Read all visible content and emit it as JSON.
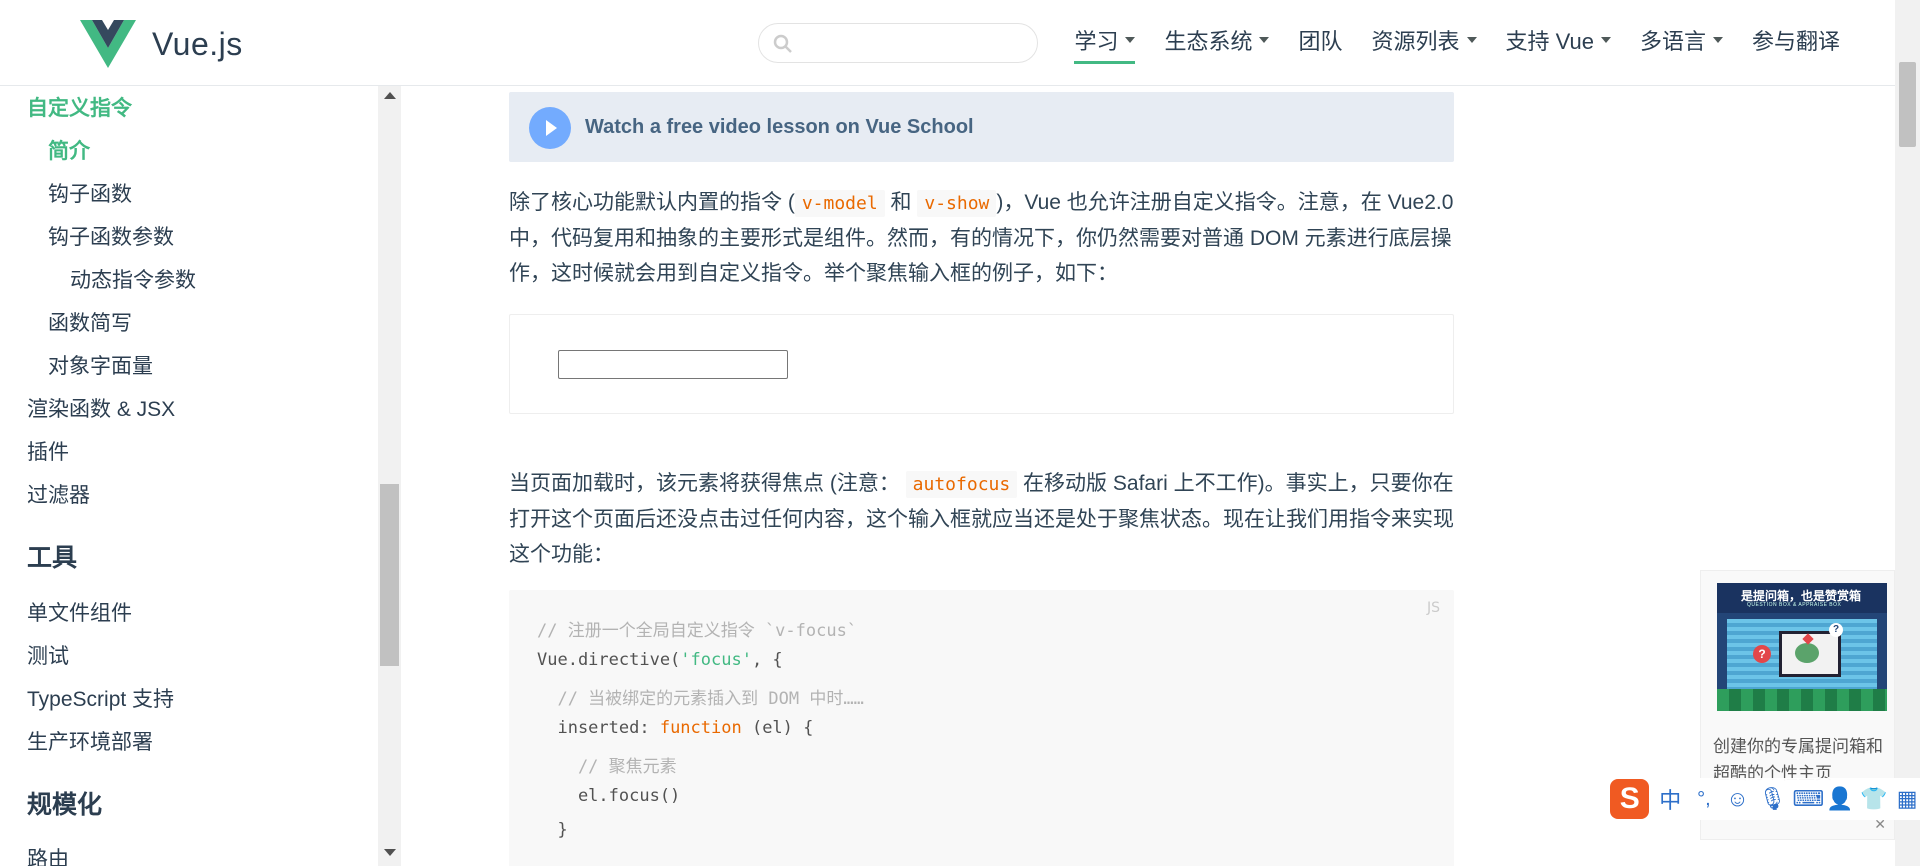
{
  "header": {
    "logo_text": "Vue.js",
    "search_placeholder": "",
    "nav": [
      {
        "label": "学习",
        "dropdown": true,
        "active": true
      },
      {
        "label": "生态系统",
        "dropdown": true
      },
      {
        "label": "团队",
        "dropdown": false
      },
      {
        "label": "资源列表",
        "dropdown": true
      },
      {
        "label": "支持 Vue",
        "dropdown": true
      },
      {
        "label": "多语言",
        "dropdown": true
      },
      {
        "label": "参与翻译",
        "dropdown": false
      }
    ]
  },
  "sidebar": {
    "items": [
      {
        "label": "自定义指令",
        "level": 0,
        "active": true
      },
      {
        "label": "简介",
        "level": 1,
        "active": true
      },
      {
        "label": "钩子函数",
        "level": 1
      },
      {
        "label": "钩子函数参数",
        "level": 1
      },
      {
        "label": "动态指令参数",
        "level": 2
      },
      {
        "label": "函数简写",
        "level": 1
      },
      {
        "label": "对象字面量",
        "level": 1
      },
      {
        "label": "渲染函数 & JSX",
        "level": 0
      },
      {
        "label": "插件",
        "level": 0
      },
      {
        "label": "过滤器",
        "level": 0
      },
      {
        "label": "工具",
        "heading": true
      },
      {
        "label": "单文件组件",
        "level": 0
      },
      {
        "label": "测试",
        "level": 0
      },
      {
        "label": "TypeScript 支持",
        "level": 0
      },
      {
        "label": "生产环境部署",
        "level": 0
      },
      {
        "label": "规模化",
        "heading": true
      },
      {
        "label": "路由",
        "level": 0
      }
    ]
  },
  "content": {
    "video_banner": "Watch a free video lesson on Vue School",
    "intro": {
      "part1": "除了核心功能默认内置的指令 (",
      "code1": "v-model",
      "part2": " 和 ",
      "code2": "v-show",
      "part3": ")，Vue 也允许注册自定义指令。注意，在 Vue2.0 中，代码复用和抽象的主要形式是组件。然而，有的情况下，你仍然需要对普通 DOM 元素进行底层操作，这时候就会用到自定义指令。举个聚焦输入框的例子，如下："
    },
    "focus_para": {
      "part1": "当页面加载时，该元素将获得焦点 (注意：",
      "code": "autofocus",
      "part2": " 在移动版 Safari 上不工作)。事实上，只要你在打开这个页面后还没点击过任何内容，这个输入框就应当还是处于聚焦状态。现在让我们用指令来实现这个功能："
    },
    "demo_input_value": "",
    "code": {
      "lang": "JS",
      "line1_comment": "// 注册一个全局自定义指令 `v-focus`",
      "line2_a": "Vue.directive(",
      "line2_str": "'focus'",
      "line2_b": ", {",
      "line3_comment": "  // 当被绑定的元素插入到 DOM 中时……",
      "line4_a": "  inserted: ",
      "line4_kw": "function",
      "line4_b": " (el) {",
      "line5_comment": "    // 聚焦元素",
      "line6": "    el.focus()",
      "line7": "  }"
    }
  },
  "ad": {
    "image_title": "是提问箱，也是赞赏箱",
    "image_subtitle": "QUESTION BOX & APPRAISE BOX",
    "text": "创建你的专属提问箱和超酷的个性主页"
  },
  "ime": {
    "logo": "S",
    "mode": "中",
    "punct": "°,"
  }
}
